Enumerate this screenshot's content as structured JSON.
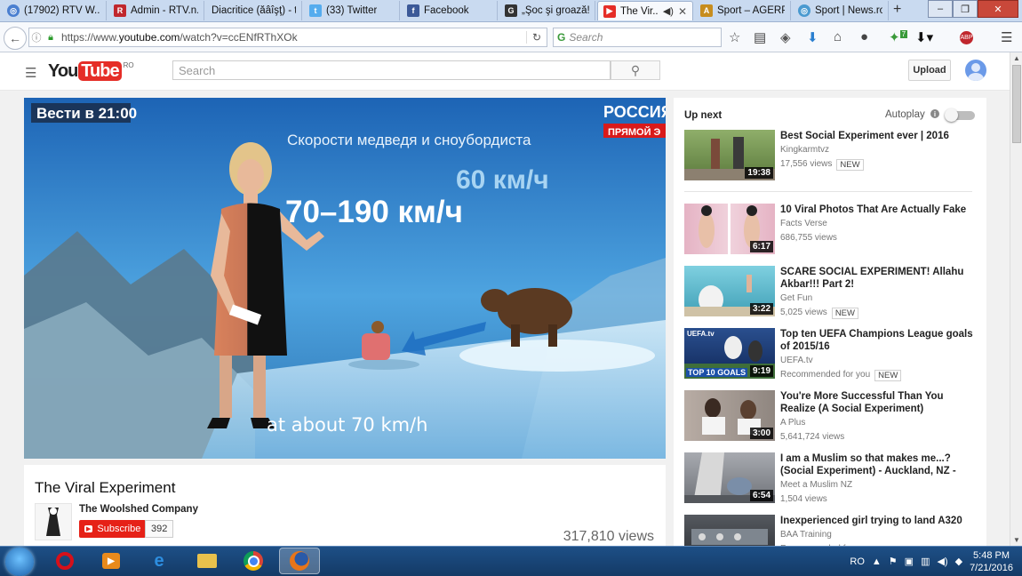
{
  "browser": {
    "tabs": [
      {
        "label": "(17902) RTV W...",
        "icon": "globe-icon",
        "color": "#4a7fd0"
      },
      {
        "label": "Admin - RTV.n...",
        "icon": "rtv-icon",
        "color": "#c0272d"
      },
      {
        "label": "Diacritice (ăâîşţ) - t...",
        "icon": "page-icon",
        "color": "#888888"
      },
      {
        "label": "(33) Twitter",
        "icon": "twitter-icon",
        "color": "#55acee"
      },
      {
        "label": "Facebook",
        "icon": "facebook-icon",
        "color": "#3b5998"
      },
      {
        "label": "„Şoc şi groază!...",
        "icon": "g-icon",
        "color": "#333333"
      },
      {
        "label": "The Vir...",
        "icon": "youtube-icon",
        "color": "#e52d27"
      },
      {
        "label": "Sport – AGERP...",
        "icon": "agerpres-icon",
        "color": "#c78d1e"
      },
      {
        "label": "Sport | News.ro",
        "icon": "globe-icon",
        "color": "#4a9ad0"
      }
    ],
    "new_tab": "+",
    "url_host": "https://www.",
    "url_domain": "youtube.com",
    "url_path": "/watch?v=ccENfRThXOk",
    "search_placeholder": "Search",
    "abp": "ABP",
    "badge": "7"
  },
  "youtube": {
    "logo_you": "You",
    "logo_tube": "Tube",
    "logo_region": "RO",
    "search_placeholder": "Search",
    "upload_label": "Upload"
  },
  "video": {
    "broadcast_logo": "Вести в 21:00",
    "channel_logo": "РОССИЯ",
    "live_badge": "ПРЯМОЙ Э",
    "graphic_title": "Скорости медведя и сноубордиста",
    "bear_speed": "60 км/ч",
    "boarder_speed": "70–190 км/ч",
    "subtitle": "at about 70 km/h"
  },
  "info": {
    "title": "The Viral Experiment",
    "channel": "The Woolshed Company",
    "subscribe_label": "Subscribe",
    "subscriber_count": "392",
    "views": "317,810 views"
  },
  "sidebar": {
    "up_next": "Up next",
    "autoplay": "Autoplay",
    "items": [
      {
        "title": "Best Social Experiment ever | 2016",
        "channel": "Kingkarmtvz",
        "meta": "17,556 views",
        "badge": "NEW",
        "duration": "19:38",
        "bg": "#6f8a4a"
      },
      {
        "title": "10 Viral Photos That Are Actually Fake",
        "channel": "Facts Verse",
        "meta": "686,755 views",
        "badge": "",
        "duration": "6:17",
        "bg": "#d98aa8"
      },
      {
        "title": "SCARE SOCIAL EXPERIMENT! Allahu Akbar!!! Part 2!",
        "channel": "Get Fun",
        "meta": "5,025 views",
        "badge": "NEW",
        "duration": "3:22",
        "bg": "#5fb6c9"
      },
      {
        "title": "Top ten UEFA Champions League goals of 2015/16",
        "channel": "UEFA.tv",
        "meta": "Recommended for you",
        "badge": "NEW",
        "duration": "9:19",
        "bg": "#1d3f7a",
        "overlay": "TOP 10 GOALS",
        "brand": "UEFA.tv"
      },
      {
        "title": "You're More Successful Than You Realize (A Social Experiment)",
        "channel": "A Plus",
        "meta": "5,641,724 views",
        "badge": "",
        "duration": "3:00",
        "bg": "#a59a93"
      },
      {
        "title": "I am a Muslim so that makes me...? (Social Experiment) - Auckland, NZ -",
        "channel": "Meet a Muslim NZ",
        "meta": "1,504 views",
        "badge": "",
        "duration": "6:54",
        "bg": "#8a8d92"
      },
      {
        "title": "Inexperienced girl trying to land A320",
        "channel": "BAA Training",
        "meta": "Recommended for you",
        "badge": "",
        "duration": "",
        "bg": "#3b3f44"
      }
    ]
  },
  "taskbar": {
    "lang": "RO",
    "time": "5:48 PM",
    "date": "7/21/2016",
    "apps": [
      {
        "name": "opera-icon",
        "color": "#d6101a"
      },
      {
        "name": "media-player-icon",
        "color": "#e88a1c"
      },
      {
        "name": "internet-explorer-icon",
        "color": "#2d8ee0"
      },
      {
        "name": "file-explorer-icon",
        "color": "#e8c14c"
      },
      {
        "name": "chrome-icon",
        "color": "#3aa852"
      },
      {
        "name": "firefox-icon",
        "color": "#e8751a"
      }
    ]
  }
}
